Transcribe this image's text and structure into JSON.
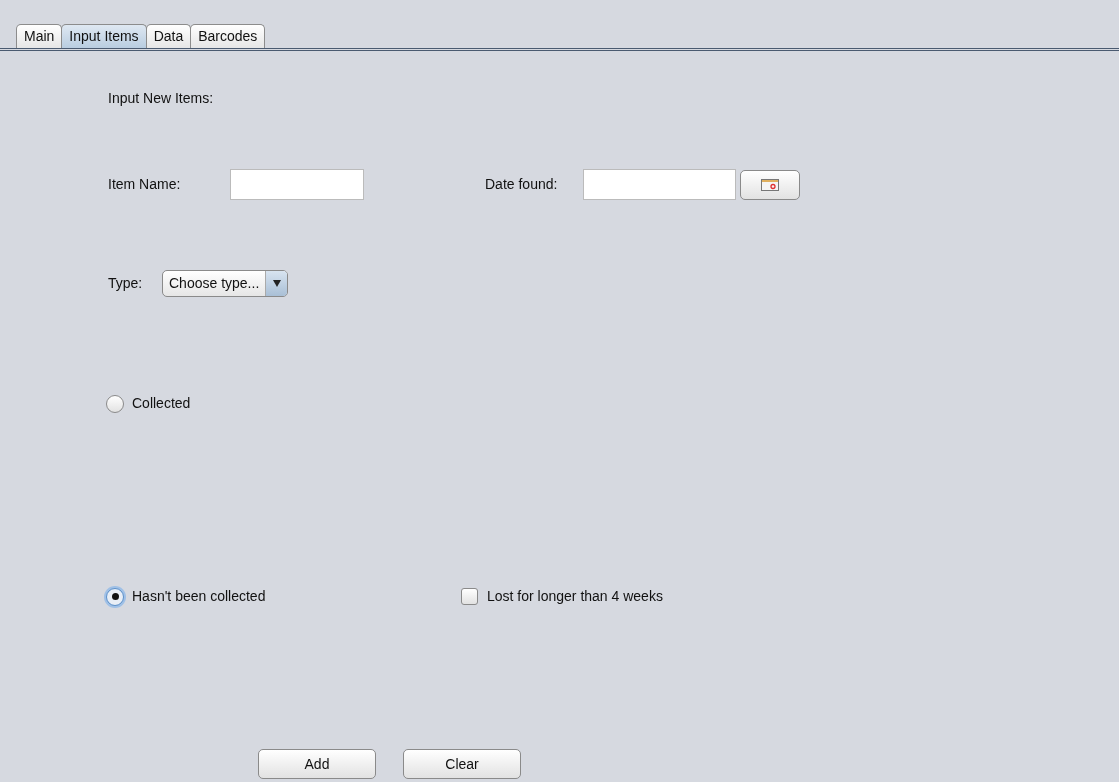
{
  "tabs": [
    {
      "label": "Main",
      "selected": false
    },
    {
      "label": "Input Items",
      "selected": true
    },
    {
      "label": "Data",
      "selected": false
    },
    {
      "label": "Barcodes",
      "selected": false
    }
  ],
  "heading": "Input New Items:",
  "item_name": {
    "label": "Item Name:"
  },
  "date_found": {
    "label": "Date found:"
  },
  "type": {
    "label": "Type:",
    "value": "Choose type..."
  },
  "status_options": [
    {
      "label": "Collected",
      "selected": false
    },
    {
      "label": "Hasn't been collected",
      "selected": true
    }
  ],
  "lost_long": {
    "label": "Lost for longer than 4 weeks",
    "checked": false
  },
  "buttons": [
    "Add",
    "Clear"
  ]
}
